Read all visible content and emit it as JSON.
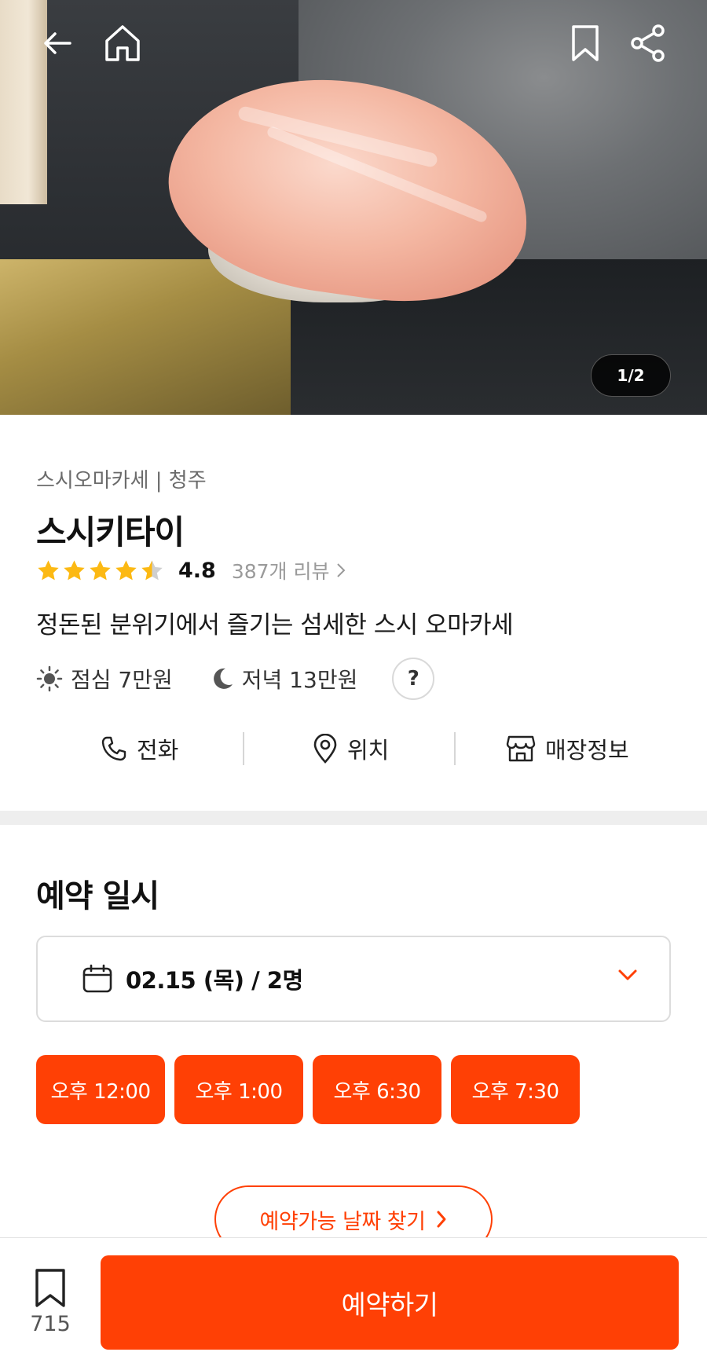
{
  "hero": {
    "page_counter": "1/2"
  },
  "restaurant": {
    "category": "스시오마카세 | 청주",
    "name": "스시키타이",
    "rating": "4.8",
    "stars": 4.5,
    "reviews_label": "387개 리뷰",
    "description": "정돈된 분위기에서 즐기는 섬세한 스시 오마카세",
    "lunch_price": "점심 7만원",
    "dinner_price": "저녁 13만원",
    "help_label": "?"
  },
  "actions": {
    "call": "전화",
    "location": "위치",
    "store_info": "매장정보"
  },
  "reservation": {
    "title": "예약 일시",
    "selected": "02.15 (목) / 2명",
    "time_slots": [
      "오후 12:00",
      "오후 1:00",
      "오후 6:30",
      "오후 7:30"
    ],
    "find_dates_label": "예약가능 날짜 찾기"
  },
  "bottom": {
    "bookmark_count": "715",
    "reserve_label": "예약하기"
  },
  "colors": {
    "accent": "#ff4005",
    "star": "#fcb913",
    "star_empty": "#cfcfcf"
  }
}
